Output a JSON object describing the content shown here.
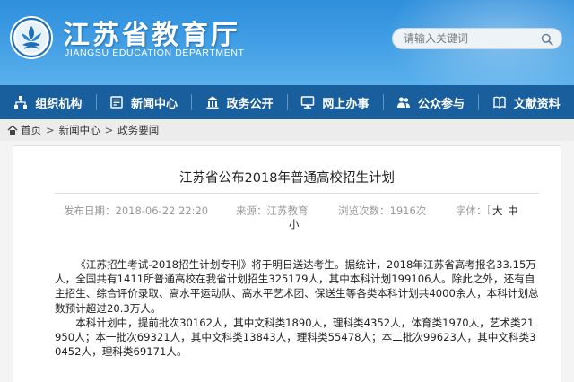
{
  "header": {
    "title": "江苏省教育厅",
    "subtitle": "JIANGSU EDUCATION DEPARTMENT",
    "search_placeholder": "请输入关键词",
    "colors": {
      "header_top": "#2f8fdc",
      "header_bottom": "#5ab0ec",
      "nav_bg": "#1a5f9d"
    }
  },
  "nav": {
    "items": [
      {
        "label": "组织机构",
        "icon": "org-chart-icon"
      },
      {
        "label": "新闻中心",
        "icon": "news-icon"
      },
      {
        "label": "政务公开",
        "icon": "government-icon"
      },
      {
        "label": "网上办事",
        "icon": "monitor-icon"
      },
      {
        "label": "公众参与",
        "icon": "people-icon"
      },
      {
        "label": "文献资料",
        "icon": "book-icon"
      }
    ]
  },
  "breadcrumb": {
    "items": [
      "首页",
      "新闻中心",
      "政务要闻"
    ],
    "separator": ">",
    "icon": "home-icon"
  },
  "article": {
    "title": "江苏省公布2018年普通高校招生计划",
    "meta": {
      "date": "发布日期：2018-06-22 22:20",
      "source": "来源：江苏教育",
      "views": "浏览次数：1916次",
      "font_label": "字体：",
      "font_large": "大",
      "font_medium": "中",
      "font_small": "小"
    },
    "paragraphs": [
      "《江苏招生考试-2018招生计划专刊》将于明日送达考生。据统计，2018年江苏省高考报名33.15万人，全国共有1411所普通高校在我省计划招生325179人，其中本科计划199106人。除此之外，还有自主招生、综合评价录取、高水平运动队、高水平艺术团、保送生等各类本科计划共4000余人，本科计划总数预计超过20.3万人。",
      "本科计划中，提前批次30162人，其中文科类1890人，理科类4352人，体育类1970人，艺术类21950人；本一批次69321人，其中文科类13843人，理科类55478人；本二批次99623人，其中文科类30452人，理科类69171人。"
    ]
  }
}
